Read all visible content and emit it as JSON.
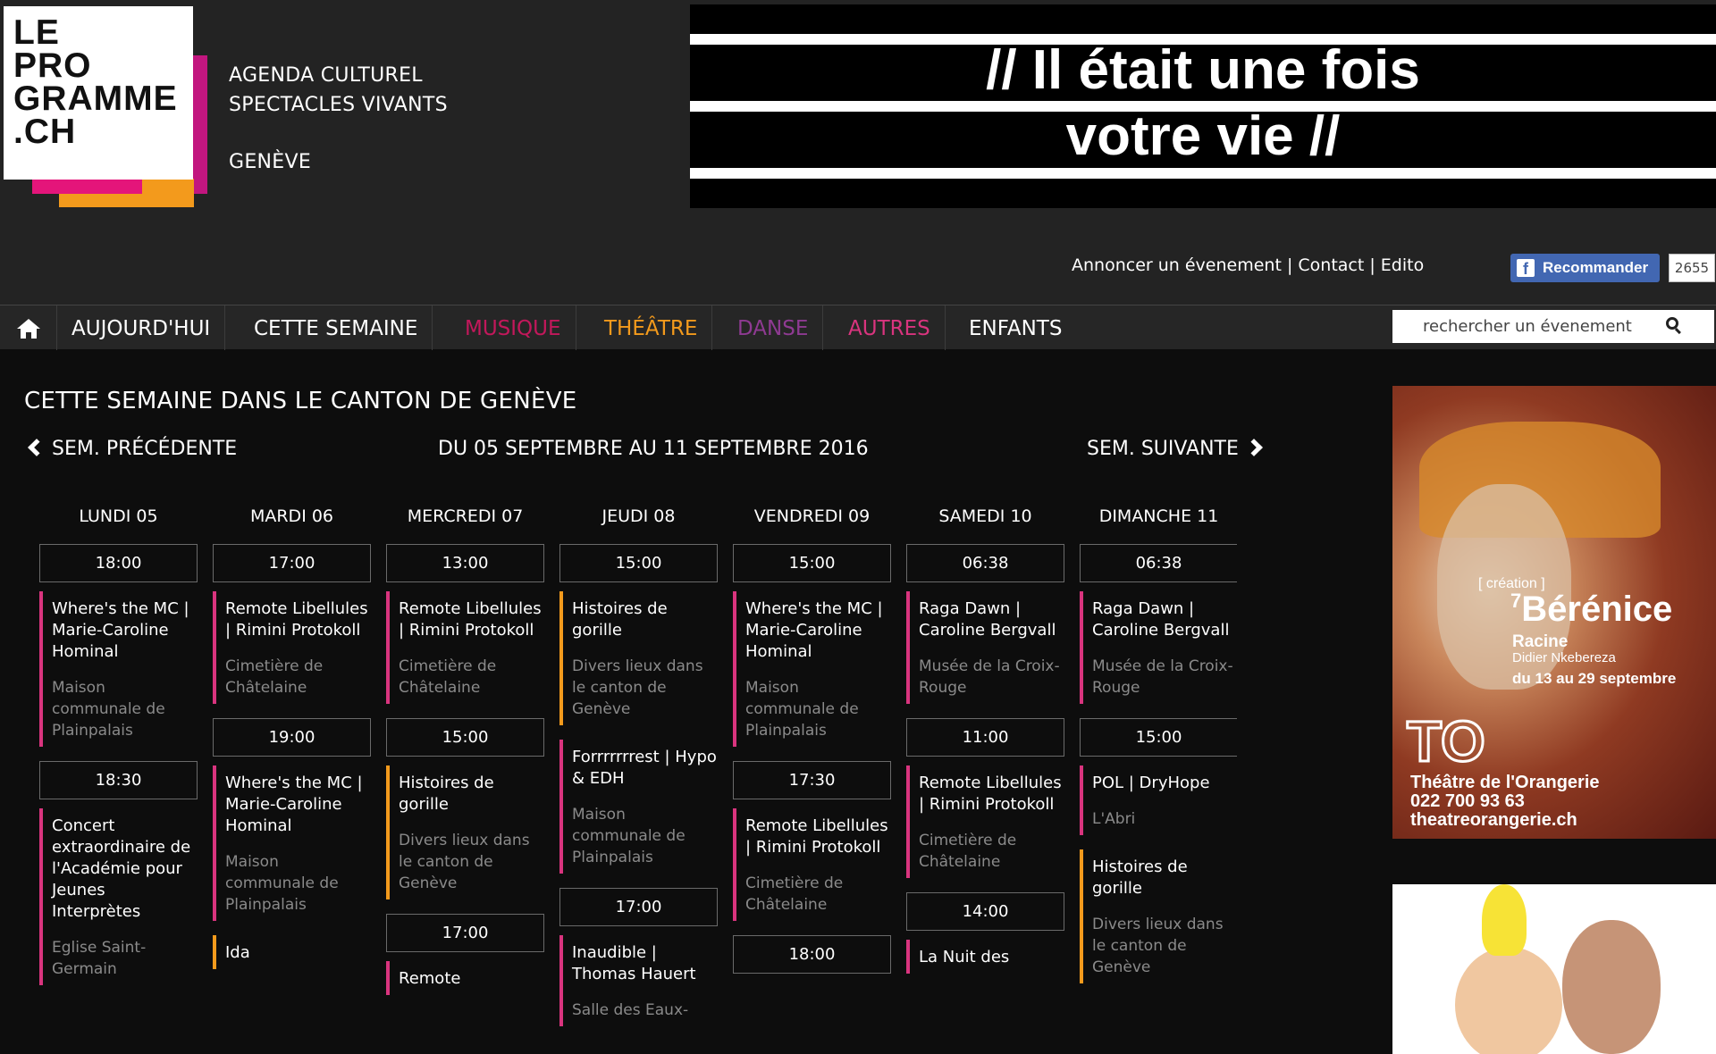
{
  "header": {
    "logo_lines": [
      "LE",
      "PRO",
      "GRAMME",
      ".CH"
    ],
    "tagline_1": "AGENDA CULTUREL",
    "tagline_2": "SPECTACLES VIVANTS",
    "city": "GENÈVE",
    "banner_line_1": "// Il était une fois",
    "banner_line_2": "votre vie //",
    "links": [
      "Annoncer un évenement",
      "Contact",
      "Edito"
    ],
    "link_separator": " | ",
    "facebook_label": "Recommander",
    "facebook_icon": "f",
    "facebook_count": "2655"
  },
  "nav": {
    "items": [
      {
        "label": "AUJOURD'HUI",
        "color": "#ffffff"
      },
      {
        "label": "CETTE SEMAINE",
        "color": "#ffffff"
      },
      {
        "label": "MUSIQUE",
        "color": "#c2185b"
      },
      {
        "label": "THÉÂTRE",
        "color": "#f39a1c"
      },
      {
        "label": "DANSE",
        "color": "#8e3a92"
      },
      {
        "label": "AUTRES",
        "color": "#d9347e"
      },
      {
        "label": "ENFANTS",
        "color": "#ffffff"
      }
    ],
    "search_placeholder": "rechercher un évenement"
  },
  "main": {
    "title": "CETTE SEMAINE DANS LE CANTON DE GENÈVE",
    "prev_week": "SEM. PRÉCÉDENTE",
    "next_week": "SEM. SUIVANTE",
    "range": "DU 05 SEPTEMBRE AU 11 SEPTEMBRE 2016"
  },
  "calendar": [
    {
      "day": "LUNDI 05",
      "slots": [
        {
          "time": "18:00",
          "events": [
            {
              "title": "Where's the MC | Marie-Caroline Hominal",
              "venue": "Maison communale de Plainpalais",
              "category": "autres"
            }
          ]
        },
        {
          "time": "18:30",
          "events": [
            {
              "title": "Concert extraordinaire de l'Académie pour Jeunes Interprètes",
              "venue": "Eglise Saint-Germain",
              "category": "musique"
            }
          ]
        }
      ]
    },
    {
      "day": "MARDI 06",
      "slots": [
        {
          "time": "17:00",
          "events": [
            {
              "title": "Remote Libellules | Rimini Protokoll",
              "venue": "Cimetière de Châtelaine",
              "category": "autres"
            }
          ]
        },
        {
          "time": "19:00",
          "events": [
            {
              "title": "Where's the MC | Marie-Caroline Hominal",
              "venue": "Maison communale de Plainpalais",
              "category": "autres"
            },
            {
              "title": "Ida",
              "venue": "",
              "category": "theatre"
            }
          ]
        }
      ]
    },
    {
      "day": "MERCREDI 07",
      "slots": [
        {
          "time": "13:00",
          "events": [
            {
              "title": "Remote Libellules | Rimini Protokoll",
              "venue": "Cimetière de Châtelaine",
              "category": "autres"
            }
          ]
        },
        {
          "time": "15:00",
          "events": [
            {
              "title": "Histoires de gorille",
              "venue": "Divers lieux dans le canton de Genève",
              "category": "theatre"
            }
          ]
        },
        {
          "time": "17:00",
          "events": [
            {
              "title": "Remote",
              "venue": "",
              "category": "autres"
            }
          ]
        }
      ]
    },
    {
      "day": "JEUDI 08",
      "slots": [
        {
          "time": "15:00",
          "events": [
            {
              "title": "Histoires de gorille",
              "venue": "Divers lieux dans le canton de Genève",
              "category": "theatre"
            },
            {
              "title": "Forrrrrrrest | Hypo & EDH",
              "venue": "Maison communale de Plainpalais",
              "category": "autres"
            }
          ]
        },
        {
          "time": "17:00",
          "events": [
            {
              "title": "Inaudible | Thomas Hauert",
              "venue": "Salle des Eaux-",
              "category": "autres"
            }
          ]
        }
      ]
    },
    {
      "day": "VENDREDI 09",
      "slots": [
        {
          "time": "15:00",
          "events": [
            {
              "title": "Where's the MC | Marie-Caroline Hominal",
              "venue": "Maison communale de Plainpalais",
              "category": "autres"
            }
          ]
        },
        {
          "time": "17:30",
          "events": [
            {
              "title": "Remote Libellules | Rimini Protokoll",
              "venue": "Cimetière de Châtelaine",
              "category": "autres"
            }
          ]
        },
        {
          "time": "18:00",
          "events": []
        }
      ]
    },
    {
      "day": "SAMEDI 10",
      "slots": [
        {
          "time": "06:38",
          "events": [
            {
              "title": "Raga Dawn | Caroline Bergvall",
              "venue": "Musée de la Croix-Rouge",
              "category": "autres"
            }
          ]
        },
        {
          "time": "11:00",
          "events": [
            {
              "title": "Remote Libellules | Rimini Protokoll",
              "venue": "Cimetière de Châtelaine",
              "category": "autres"
            }
          ]
        },
        {
          "time": "14:00",
          "events": [
            {
              "title": "La Nuit des",
              "venue": "",
              "category": "autres"
            }
          ]
        }
      ]
    },
    {
      "day": "DIMANCHE 11",
      "slots": [
        {
          "time": "06:38",
          "events": [
            {
              "title": "Raga Dawn | Caroline Bergvall",
              "venue": "Musée de la Croix-Rouge",
              "category": "autres"
            }
          ]
        },
        {
          "time": "15:00",
          "events": [
            {
              "title": "POL | DryHope",
              "venue": "L'Abri",
              "category": "autres"
            },
            {
              "title": "Histoires de gorille",
              "venue": "Divers lieux dans le canton de Genève",
              "category": "theatre"
            }
          ]
        }
      ]
    }
  ],
  "ads": {
    "berenice": {
      "tag": "[ création ]",
      "number": "7",
      "title": "Bérénice",
      "author": "Racine",
      "director": "Didier Nkebereza",
      "dates": "du 13 au 29 septembre",
      "logo": "TO",
      "venue_1": "Théâtre de l'Orangerie",
      "venue_2": "022 700 93 63",
      "venue_3": "theatreorangerie.ch"
    }
  },
  "colors": {
    "accent_pink": "#d9347e",
    "accent_orange": "#f39a1c",
    "header_bg": "#232323",
    "page_bg": "#0d0d0d"
  },
  "icons": [
    "home-icon",
    "search-icon",
    "chevron-left-icon",
    "chevron-right-icon",
    "facebook-icon"
  ]
}
